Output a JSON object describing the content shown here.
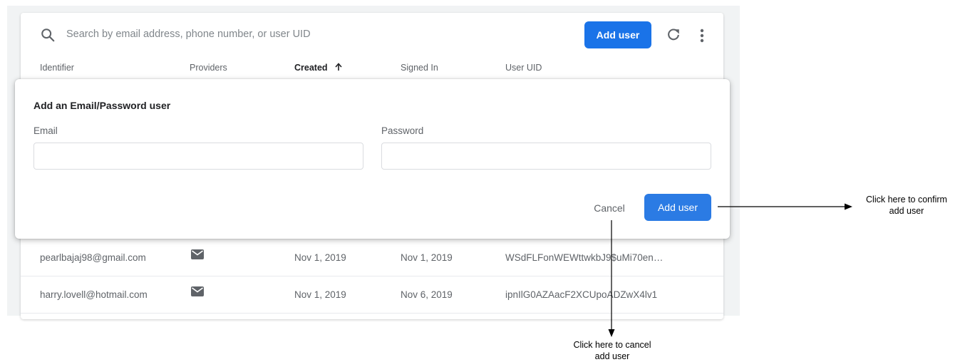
{
  "search": {
    "placeholder": "Search by email address, phone number, or user UID"
  },
  "toolbar": {
    "add_user_label": "Add user",
    "refresh_icon": "refresh-icon",
    "more_icon": "more-vert-icon"
  },
  "table": {
    "columns": [
      {
        "key": "identifier",
        "label": "Identifier"
      },
      {
        "key": "providers",
        "label": "Providers"
      },
      {
        "key": "created",
        "label": "Created",
        "sorted": "ascending"
      },
      {
        "key": "signed_in",
        "label": "Signed In"
      },
      {
        "key": "user_uid",
        "label": "User UID"
      }
    ],
    "rows": [
      {
        "identifier": "pearlbajaj98@gmail.com",
        "provider_icon": "email-icon",
        "created": "Nov 1, 2019",
        "signed_in": "Nov 1, 2019",
        "uid": "WSdFLFonWEWttwkbJ9$uMi70en…"
      },
      {
        "identifier": "harry.lovell@hotmail.com",
        "provider_icon": "email-icon",
        "created": "Nov 1, 2019",
        "signed_in": "Nov 6, 2019",
        "uid": "ipnIlG0AZAacF2XCUpoADZwX4lv1"
      }
    ]
  },
  "dialog": {
    "title": "Add an Email/Password user",
    "email_label": "Email",
    "email_value": "",
    "password_label": "Password",
    "password_value": "",
    "cancel_label": "Cancel",
    "confirm_label": "Add user"
  },
  "annotations": {
    "confirm_line1": "Click here to confirm",
    "confirm_line2": "add user",
    "cancel_line1": "Click here to cancel",
    "cancel_line2": "add user"
  },
  "colors": {
    "primary": "#1a73e8",
    "dialog_button": "#2b7be4",
    "background": "#f1f3f4"
  }
}
